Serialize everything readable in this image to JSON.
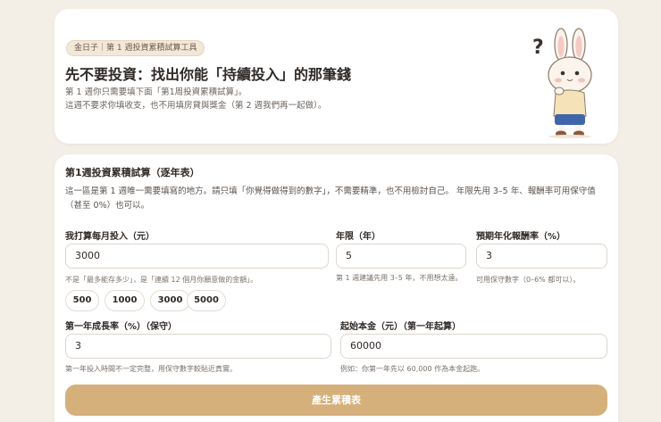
{
  "hero": {
    "badge": "金日子｜第 1 週投資累積試算工具",
    "title": "先不要投資：找出你能「持續投入」的那筆錢",
    "desc_line1": "第 1 週你只需要填下面「第1周投資累積試算」。",
    "desc_line2": "這週不要求你填收支，也不用填房貸與獎金（第 2 週我們再一起做）。"
  },
  "calc": {
    "title": "第1週投資累積試算（逐年表）",
    "desc": "這一區是第 1 週唯一需要填寫的地方。請只填「你覺得做得到的數字」，不需要精準，也不用檢討自己。 年限先用 3–5 年、報酬率可用保守值（甚至 0%）也可以。",
    "monthly": {
      "label": "我打算每月投入（元）",
      "value": "3000",
      "hint": "不是「最多能存多少」，是「連續 12 個月你願意做的金額」。"
    },
    "years": {
      "label": "年限（年）",
      "value": "5",
      "hint": "第 1 週建議先用 3–5 年，不用想太遠。"
    },
    "rate": {
      "label": "預期年化報酬率（%）",
      "value": "3",
      "hint": "可用保守數字（0–6% 都可以）。"
    },
    "presets": [
      "500",
      "1000",
      "3000",
      "5000"
    ],
    "growth": {
      "label": "第一年成長率（%）（保守）",
      "value": "3",
      "hint": "第一年投入時間不一定完整，用保守數字較貼近真實。"
    },
    "principal": {
      "label": "起始本金（元）（第一年起算）",
      "value": "60000",
      "hint": "例如：你第一年先以 60,000 作為本金起跑。"
    },
    "submit_label": "產生累積表"
  },
  "colors": {
    "accent": "#d5b07a",
    "page_bg": "#f3eee6"
  }
}
